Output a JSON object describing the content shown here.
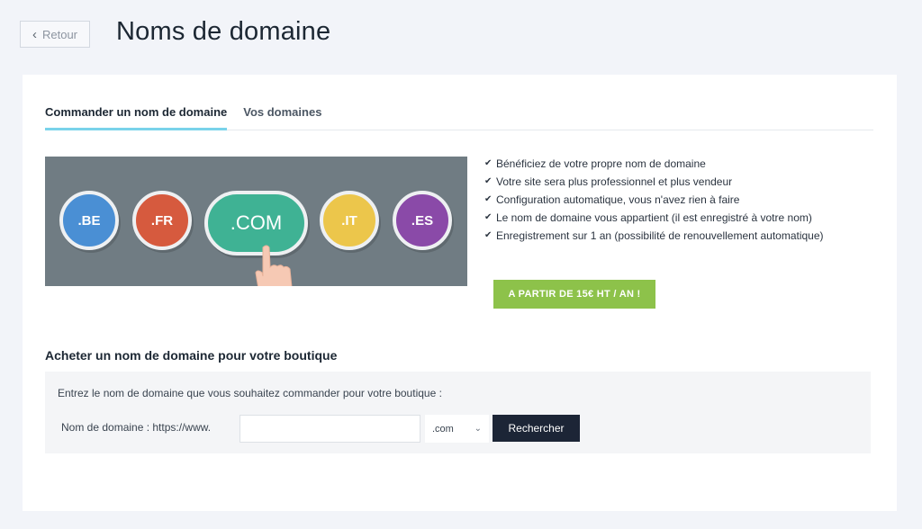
{
  "header": {
    "back_label": "Retour",
    "back_icon": "chevron-left-icon",
    "title": "Noms de domaine"
  },
  "tabs": [
    {
      "label": "Commander un nom de domaine",
      "active": true
    },
    {
      "label": "Vos domaines",
      "active": false
    }
  ],
  "banner": {
    "extensions": [
      {
        "label": ".BE",
        "color": "#4a8fd4"
      },
      {
        "label": ".FR",
        "color": "#d65a3e"
      },
      {
        "label": ".COM",
        "color": "#3fb294"
      },
      {
        "label": ".IT",
        "color": "#ecc64b"
      },
      {
        "label": ".ES",
        "color": "#8a4aa8"
      }
    ],
    "background_color": "#707c83"
  },
  "features": [
    "Bénéficiez de votre propre nom de domaine",
    "Votre site sera plus professionnel et plus vendeur",
    "Configuration automatique, vous n'avez rien à faire",
    "Le nom de domaine vous appartient (il est enregistré à votre nom)",
    "Enregistrement sur 1 an (possibilité de renouvellement automatique)"
  ],
  "cta_label": "A PARTIR DE 15€ HT / AN !",
  "purchase": {
    "section_title": "Acheter un nom de domaine pour votre boutique",
    "instructions": "Entrez le nom de domaine que vous souhaitez commander pour votre boutique :",
    "domain_label": "Nom de domaine : https://www.",
    "domain_value": "",
    "tld_selected": ".com",
    "search_label": "Rechercher"
  },
  "colors": {
    "accent_tab": "#7ad3ea",
    "cta": "#8dc24a",
    "search_button": "#1c2536"
  }
}
